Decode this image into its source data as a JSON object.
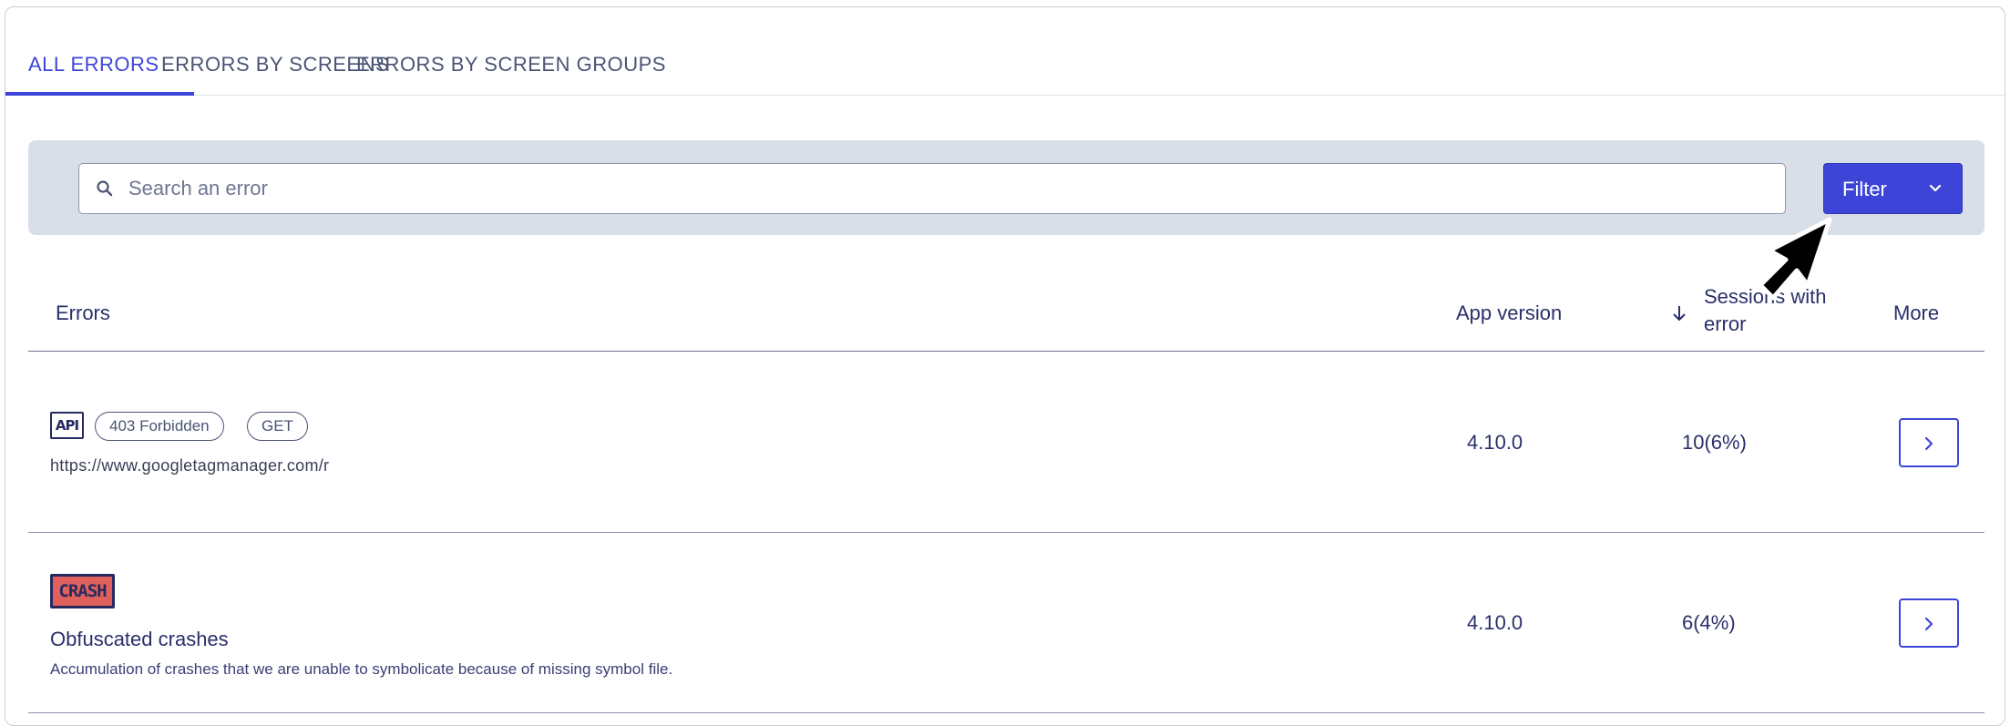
{
  "tabs": [
    {
      "label": "ALL ERRORS",
      "active": true
    },
    {
      "label": "ERRORS BY SCREENS",
      "active": false
    },
    {
      "label": "ERRORS BY SCREEN GROUPS",
      "active": false
    }
  ],
  "search": {
    "placeholder": "Search an error",
    "icon": "search-icon"
  },
  "filter": {
    "label": "Filter",
    "icon": "chevron-down-icon"
  },
  "table": {
    "headers": {
      "errors": "Errors",
      "app_version": "App version",
      "sessions_line1": "Sessions with",
      "sessions_line2": "error",
      "more": "More"
    },
    "rows": [
      {
        "type_badge": "API",
        "status_pill": "403 Forbidden",
        "method_pill": "GET",
        "url": "https://www.googletagmanager.com/r",
        "app_version": "4.10.0",
        "sessions": "10(6%)"
      },
      {
        "type_badge": "CRASH",
        "title": "Obfuscated crashes",
        "description": "Accumulation of crashes that we are unable to symbolicate because of missing symbol file.",
        "app_version": "4.10.0",
        "sessions": "6(4%)"
      }
    ]
  },
  "colors": {
    "accent": "#3d45d8",
    "searchbar_bg": "#d9dfe8",
    "crash_badge": "#e0605d",
    "text": "#2a2f6b"
  }
}
